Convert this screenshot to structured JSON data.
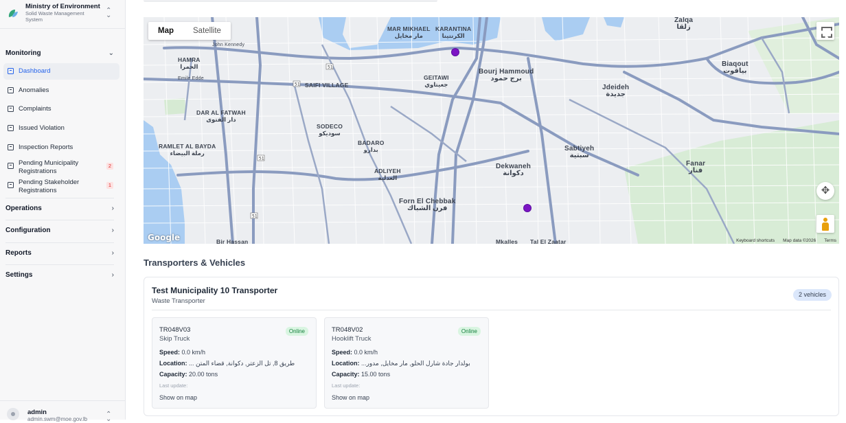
{
  "brand": {
    "title": "Ministry of Environment",
    "subtitle": "Solid Waste Management System"
  },
  "sidebar": {
    "monitoring_label": "Monitoring",
    "items": [
      {
        "label": "Dashboard",
        "active": true
      },
      {
        "label": "Anomalies"
      },
      {
        "label": "Complaints"
      },
      {
        "label": "Issued Violation"
      },
      {
        "label": "Inspection Reports"
      },
      {
        "label": "Pending Municipality Registrations",
        "badge": "2"
      },
      {
        "label": "Pending Stakeholder Registrations",
        "badge": "1"
      }
    ],
    "sections": [
      "Operations",
      "Configuration",
      "Reports",
      "Settings"
    ]
  },
  "user": {
    "name": "admin",
    "email": "admin.swm@moe.gov.lb"
  },
  "map": {
    "type_options": [
      "Map",
      "Satellite"
    ],
    "selected_type": "Map",
    "attribution": "Google",
    "footer": [
      "Keyboard shortcuts",
      "Map data ©2026",
      "Terms"
    ],
    "places": [
      "MAR MIKHAEL",
      "مار مخايل",
      "KARANTINA",
      "الكرنتينا",
      "John Kennedy",
      "HAMRA",
      "الحمرا",
      "Emile Edde",
      "SAIFI VILLAGE",
      "GEITAWI",
      "جعيتاوي",
      "Bourj Hammoud",
      "برج حمود",
      "Jdeideh",
      "جديدة",
      "Biaqout",
      "بياقوت",
      "Zalqa",
      "زلقا",
      "DAR AL FATWAH",
      "دار الفتوى",
      "SODECO",
      "سوديكو",
      "BADARO",
      "بدارو",
      "ADLIYEH",
      "العدلية",
      "Sabtiyeh",
      "سبتية",
      "Fanar",
      "فنار",
      "Dekwaneh",
      "دكوانة",
      "RAMLET AL BAYDA",
      "رملة البيضاء",
      "Forn El Chebbak",
      "فرن الشباك",
      "Mkalles",
      "Tal El Zaatar",
      "Bir Hassan"
    ]
  },
  "section_title": "Transporters & Vehicles",
  "transporter": {
    "name": "Test Municipality 10 Transporter",
    "type": "Waste Transporter",
    "count": "2 vehicles",
    "vehicles": [
      {
        "id": "TR048V03",
        "kind": "Skip Truck",
        "status": "Online",
        "speed_label": "Speed:",
        "speed": "0.0 km/h",
        "location_label": "Location:",
        "location": "طريق 8, تل الزعتر, دكوانة, قضاء المتن ...",
        "capacity_label": "Capacity:",
        "capacity": "20.00 tons",
        "last_update": "Last update:",
        "link": "Show on map"
      },
      {
        "id": "TR048V02",
        "kind": "Hooklift Truck",
        "status": "Online",
        "speed_label": "Speed:",
        "speed": "0.0 km/h",
        "location_label": "Location:",
        "location": "بولدار جادة شارل الحلو, مار مخايل, مدور...",
        "capacity_label": "Capacity:",
        "capacity": "15.00 tons",
        "last_update": "Last update:",
        "link": "Show on map"
      }
    ]
  },
  "colors": {
    "accent": "#2563eb",
    "pin": "#7c14c4",
    "online": "#15803d",
    "badge": "#dc2626"
  }
}
